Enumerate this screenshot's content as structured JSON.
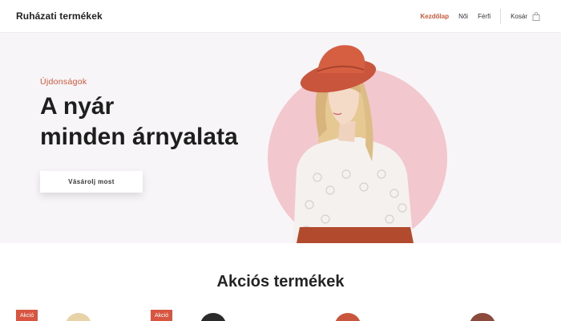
{
  "header": {
    "brand": "Ruházati termékek",
    "nav": [
      {
        "label": "Kezdőlap",
        "active": true
      },
      {
        "label": "Női",
        "active": false
      },
      {
        "label": "Férfi",
        "active": false
      }
    ],
    "cart_label": "Kosár",
    "cart_icon": "shopping-bag-icon"
  },
  "hero": {
    "kicker": "Újdonságok",
    "title_line1": "A nyár",
    "title_line2": "minden árnyalata",
    "cta_label": "Vásárolj most"
  },
  "promo": {
    "title": "Akciós termékek",
    "badge_label": "Akció"
  },
  "colors": {
    "accent": "#d2553a",
    "hero_background": "#f7f5f7",
    "hero_circle": "#f2c7cd",
    "badge": "#d9553f"
  }
}
